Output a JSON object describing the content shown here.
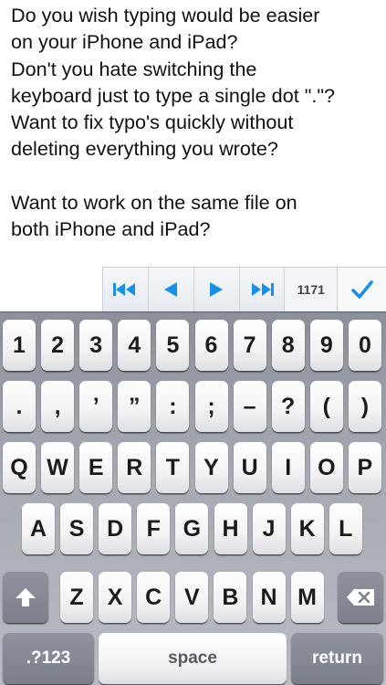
{
  "editor": {
    "text": "Do you wish typing would be easier\non your iPhone and iPad?\nDon't you hate switching the\nkeyboard just to type a single dot \".\"?\nWant to fix typo's quickly without\ndeleting everything you wrote?\n\nWant to work on the same file on\nboth iPhone and iPad?"
  },
  "toolbar": {
    "counter": "1171",
    "accent_color": "#1a8fe6"
  },
  "keyboard": {
    "row_digits": [
      "1",
      "2",
      "3",
      "4",
      "5",
      "6",
      "7",
      "8",
      "9",
      "0"
    ],
    "row_symbols": [
      ".",
      ",",
      "’",
      "”",
      ":",
      ";",
      "–",
      "?",
      "(",
      ")"
    ],
    "row_q": [
      "Q",
      "W",
      "E",
      "R",
      "T",
      "Y",
      "U",
      "I",
      "O",
      "P"
    ],
    "row_a": [
      "A",
      "S",
      "D",
      "F",
      "G",
      "H",
      "J",
      "K",
      "L"
    ],
    "row_z": [
      "Z",
      "X",
      "C",
      "V",
      "B",
      "N",
      "M"
    ],
    "numbers_label": ".?123",
    "space_label": "space",
    "return_label": "return"
  }
}
